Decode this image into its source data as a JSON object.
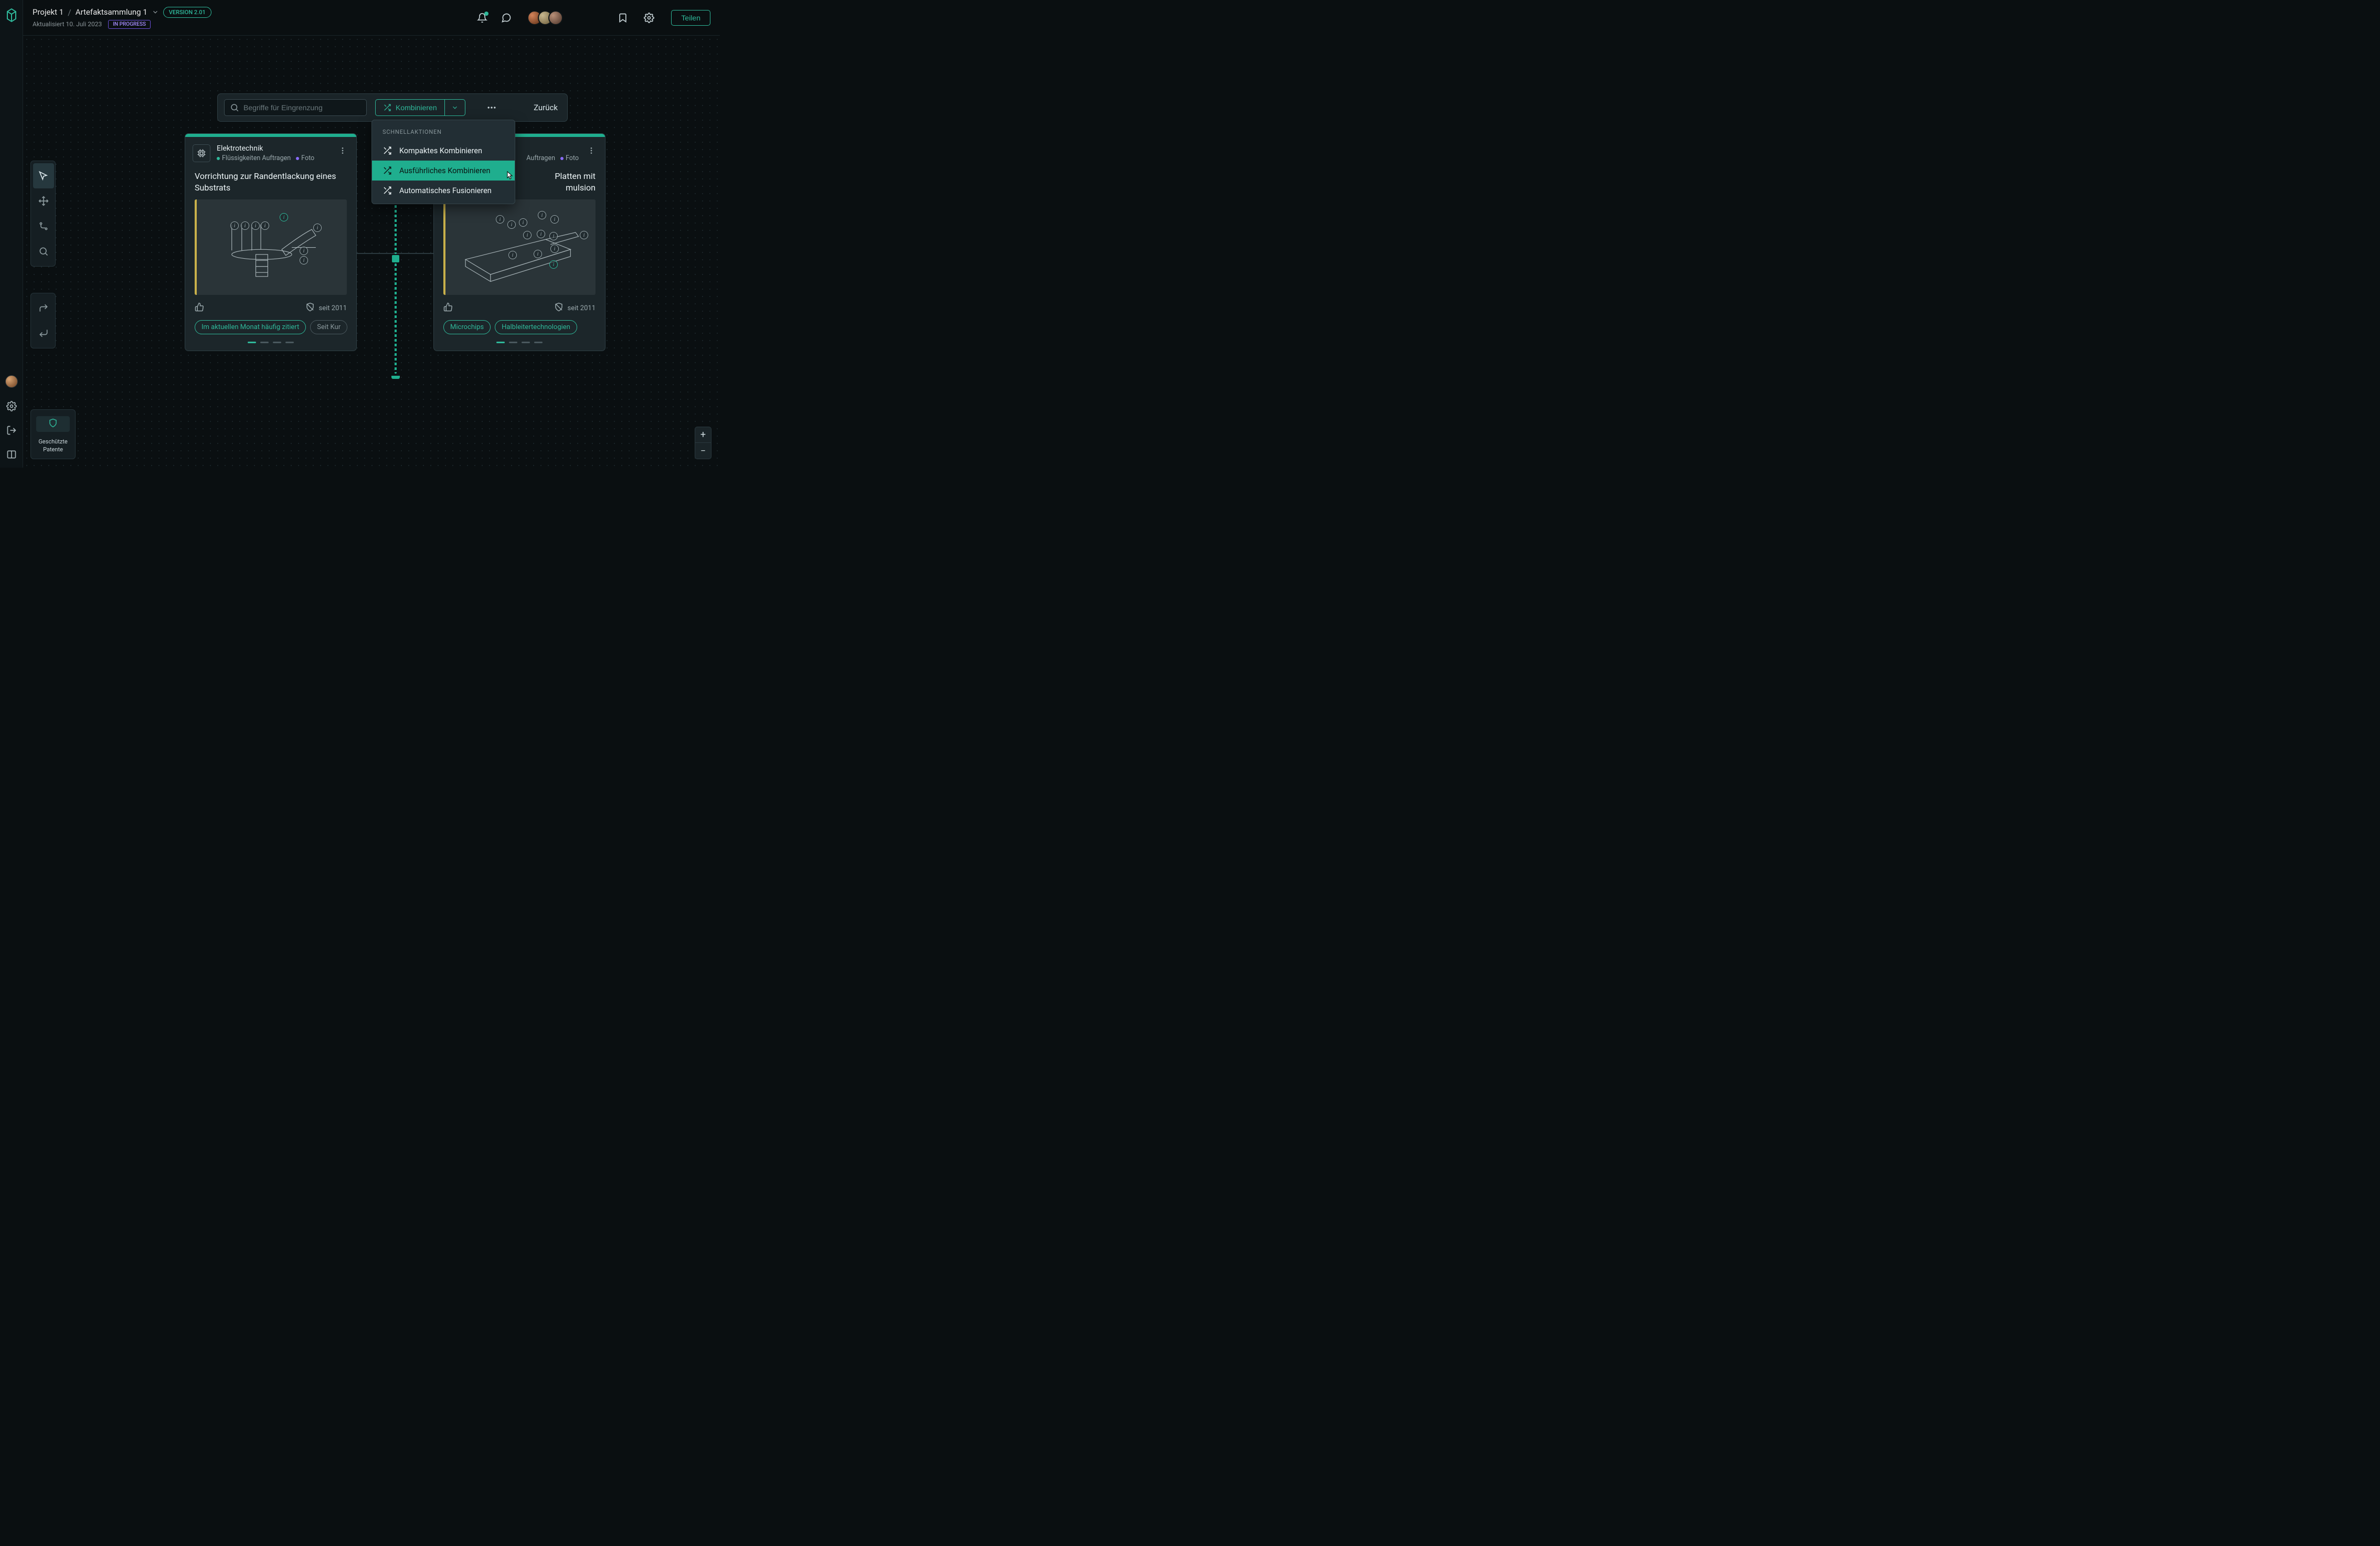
{
  "breadcrumb": {
    "crumb1": "Projekt 1",
    "crumb2": "Artefaktsammlung 1",
    "version": "VERSION 2.01",
    "updated": "Aktualisiert 10. Juli 2023",
    "status": "IN PROGRESS"
  },
  "topbar": {
    "share": "Teilen"
  },
  "actionbar": {
    "search_placeholder": "Begriffe für Eingrenzung",
    "combine": "Kombinieren",
    "back": "Zurück"
  },
  "dropdown": {
    "header": "SCHNELLAKTIONEN",
    "items": [
      "Kompaktes Kombinieren",
      "Ausführliches Kombinieren",
      "Automatisches Fusionieren"
    ]
  },
  "card1": {
    "category": "Elektrotechnik",
    "tag1": "Flüssigkeiten Auftragen",
    "tag2": "Foto",
    "title": "Vorrichtung zur Randentlackung eines Substrats",
    "since": "seit 2011",
    "chip1": "Im aktuellen Monat häufig zitiert",
    "chip2": "Seit Kur"
  },
  "card2": {
    "category_partial": "",
    "tag1_partial": "Auftragen",
    "tag2": "Foto",
    "title_partial1": "Platten mit",
    "title_partial2": "mulsion",
    "since": "seit 2011",
    "chip1": "Microchips",
    "chip2": "Halbleitertechnologien"
  },
  "legend": {
    "line1": "Geschützte",
    "line2": "Patente"
  }
}
